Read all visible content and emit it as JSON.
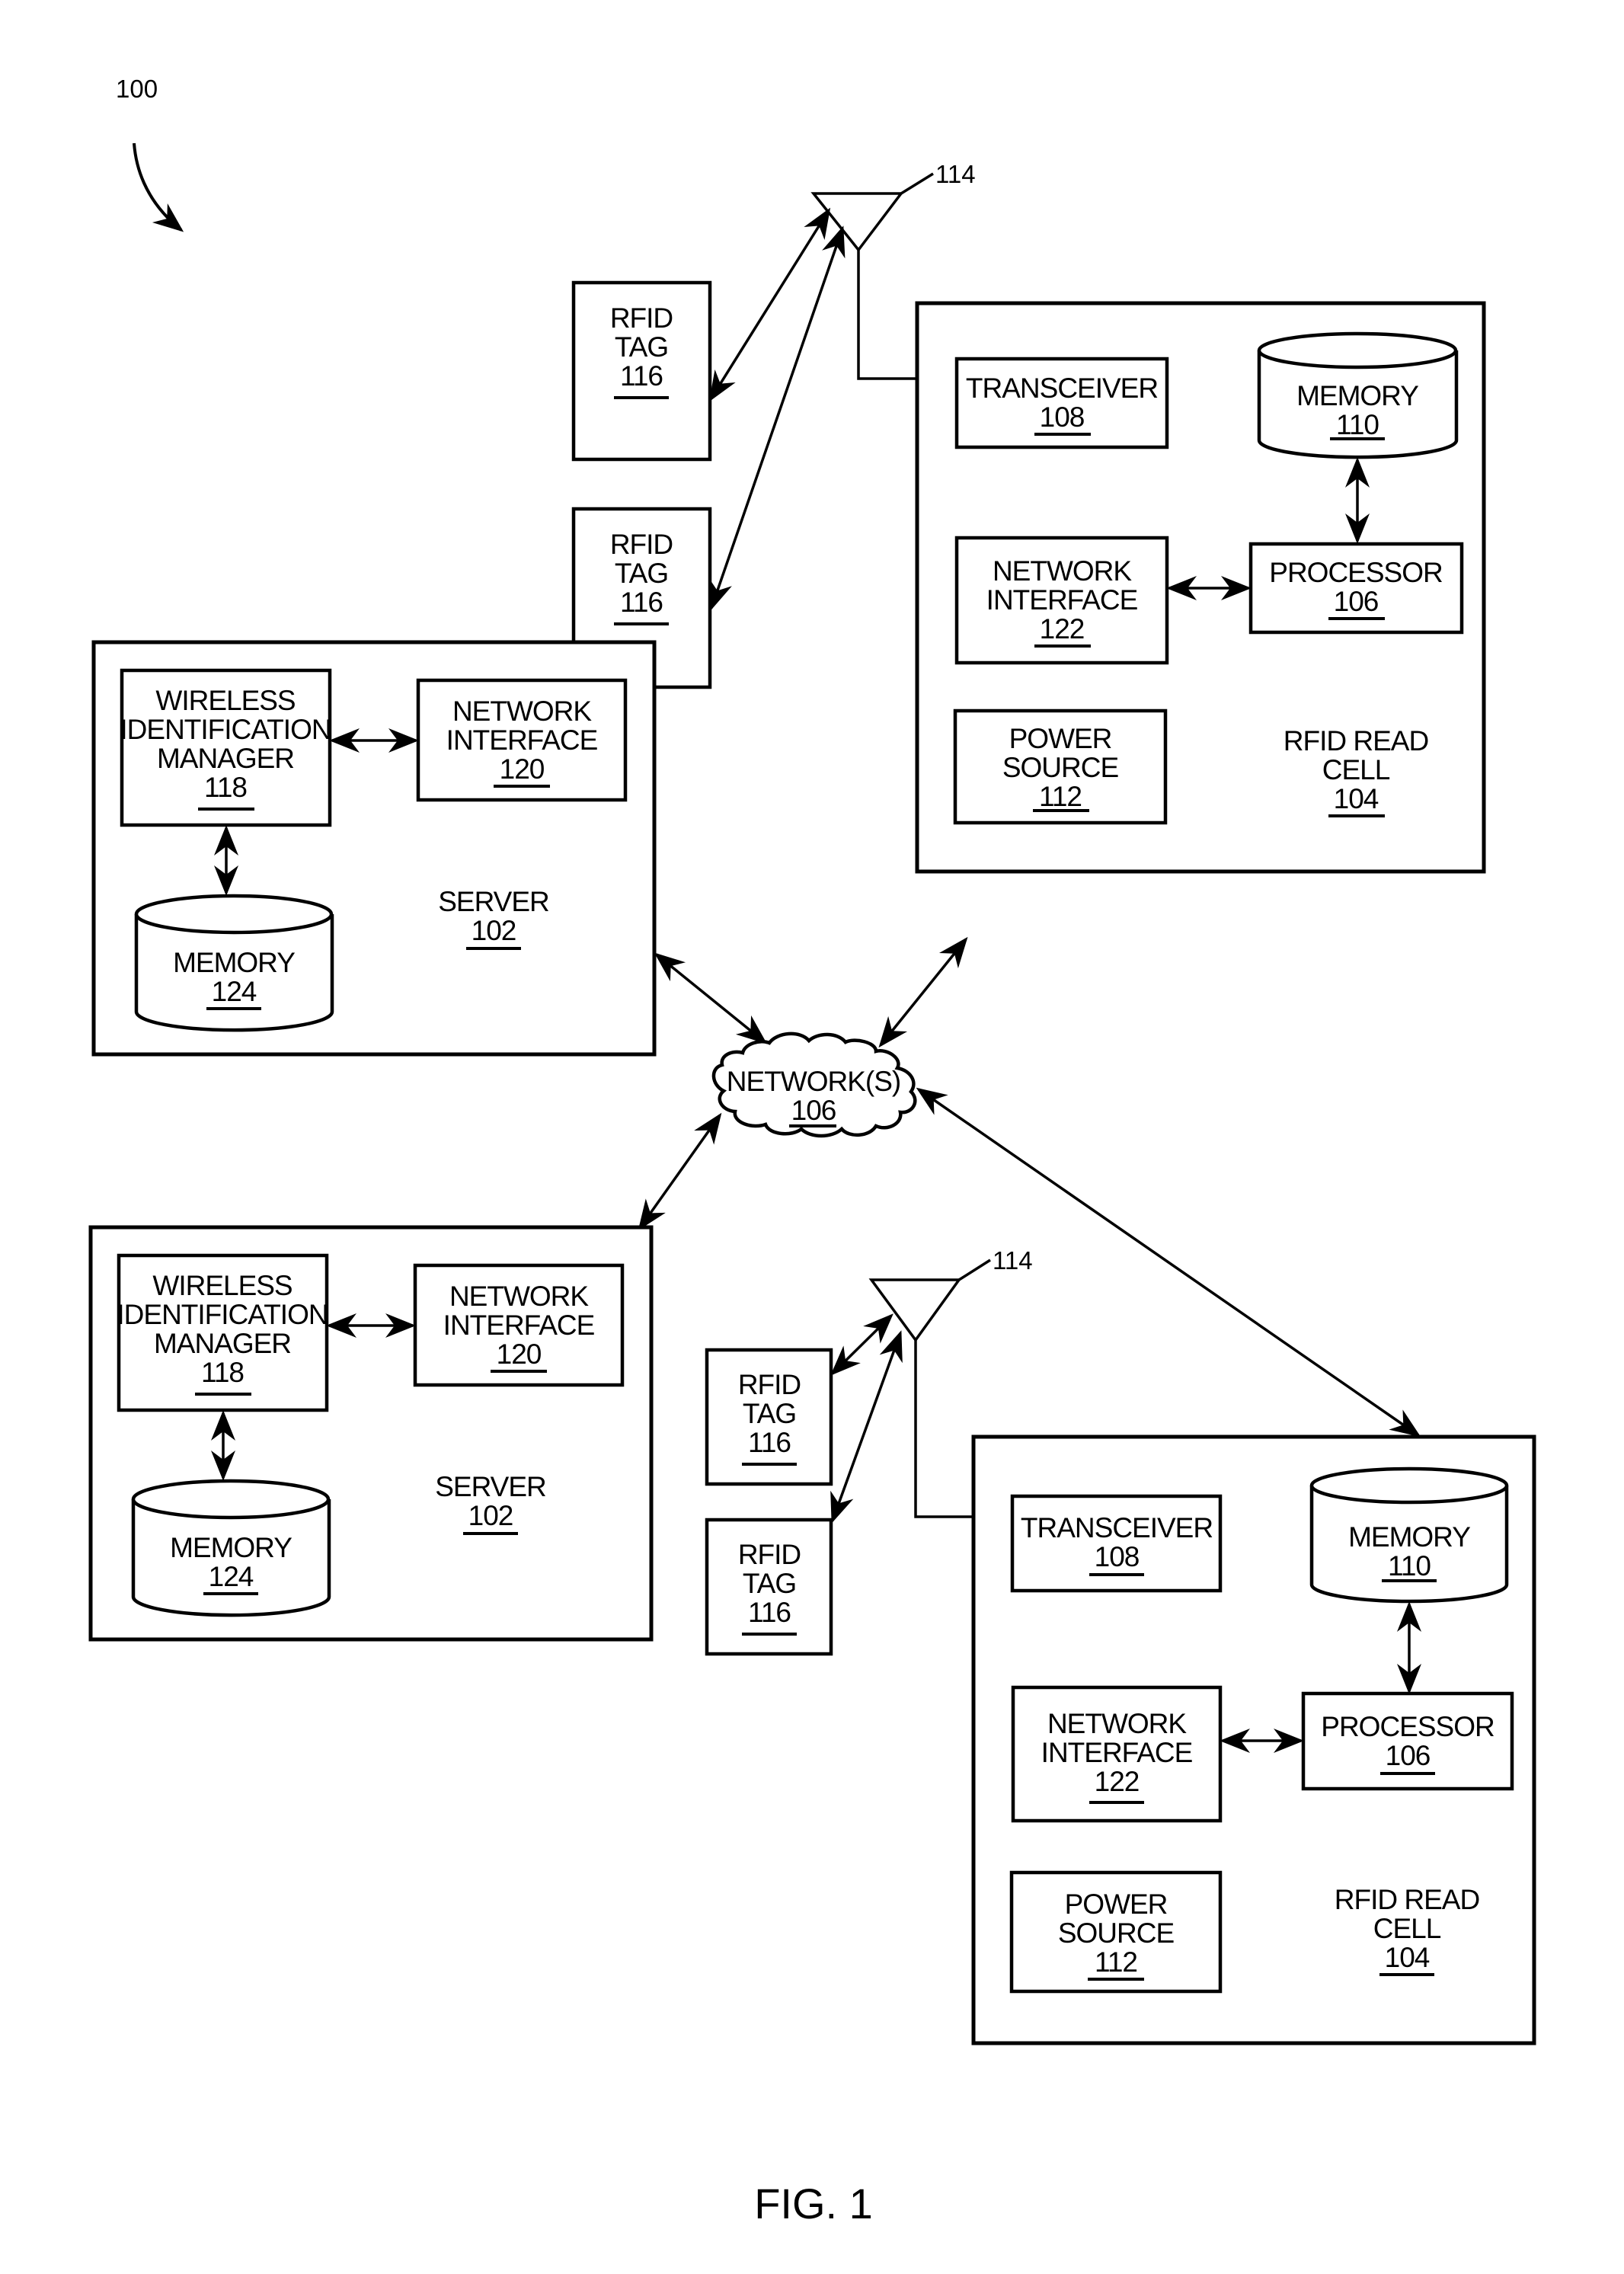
{
  "figure": {
    "caption": "FIG. 1",
    "system_ref": "100",
    "network": {
      "name": "NETWORK(S)",
      "ref": "106"
    },
    "servers": [
      {
        "name": "SERVER",
        "ref": "102",
        "wim": {
          "lines": [
            "WIRELESS",
            "IDENTIFICATION",
            "MANAGER"
          ],
          "ref": "118"
        },
        "network_interface": {
          "lines": [
            "NETWORK",
            "INTERFACE"
          ],
          "ref": "120"
        },
        "memory": {
          "name": "MEMORY",
          "ref": "124"
        }
      },
      {
        "name": "SERVER",
        "ref": "102",
        "wim": {
          "lines": [
            "WIRELESS",
            "IDENTIFICATION",
            "MANAGER"
          ],
          "ref": "118"
        },
        "network_interface": {
          "lines": [
            "NETWORK",
            "INTERFACE"
          ],
          "ref": "120"
        },
        "memory": {
          "name": "MEMORY",
          "ref": "124"
        }
      }
    ],
    "read_cells": [
      {
        "name_lines": [
          "RFID READ",
          "CELL"
        ],
        "ref": "104",
        "transceiver": {
          "name": "TRANSCEIVER",
          "ref": "108"
        },
        "memory": {
          "name": "MEMORY",
          "ref": "110"
        },
        "network_interface": {
          "lines": [
            "NETWORK",
            "INTERFACE"
          ],
          "ref": "122"
        },
        "processor": {
          "name": "PROCESSOR",
          "ref": "106"
        },
        "power_source": {
          "lines": [
            "POWER",
            "SOURCE"
          ],
          "ref": "112"
        },
        "antenna_ref": "114",
        "tags": [
          {
            "lines": [
              "RFID",
              "TAG"
            ],
            "ref": "116"
          },
          {
            "lines": [
              "RFID",
              "TAG"
            ],
            "ref": "116"
          }
        ]
      },
      {
        "name_lines": [
          "RFID READ",
          "CELL"
        ],
        "ref": "104",
        "transceiver": {
          "name": "TRANSCEIVER",
          "ref": "108"
        },
        "memory": {
          "name": "MEMORY",
          "ref": "110"
        },
        "network_interface": {
          "lines": [
            "NETWORK",
            "INTERFACE"
          ],
          "ref": "122"
        },
        "processor": {
          "name": "PROCESSOR",
          "ref": "106"
        },
        "power_source": {
          "lines": [
            "POWER",
            "SOURCE"
          ],
          "ref": "112"
        },
        "antenna_ref": "114",
        "tags": [
          {
            "lines": [
              "RFID",
              "TAG"
            ],
            "ref": "116"
          },
          {
            "lines": [
              "RFID",
              "TAG"
            ],
            "ref": "116"
          }
        ]
      }
    ]
  }
}
